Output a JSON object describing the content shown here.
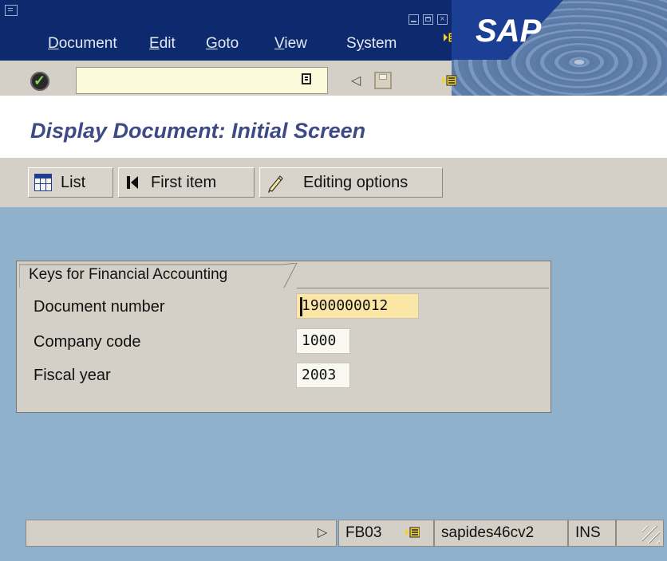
{
  "menubar": {
    "items": [
      {
        "label": "Document",
        "accel": "D",
        "rest": "ocument"
      },
      {
        "label": "Edit",
        "accel": "E",
        "rest": "dit"
      },
      {
        "label": "Goto",
        "accel": "G",
        "rest": "oto"
      },
      {
        "label": "View",
        "accel": "V",
        "rest": "iew"
      },
      {
        "label": "System",
        "pre": "S",
        "accel": "y",
        "rest": "stem"
      }
    ],
    "logo_text": "SAP"
  },
  "toolbar": {
    "command_field_value": "",
    "icons": [
      "ok-icon",
      "command-dropdown-icon",
      "back-icon",
      "save-icon",
      "layout-menu-icon"
    ]
  },
  "page": {
    "title": "Display Document: Initial Screen"
  },
  "app_toolbar": {
    "list_label": "List",
    "first_item_label": "First item",
    "editing_options_label": "Editing options"
  },
  "keys_group": {
    "title": "Keys for Financial Accounting",
    "fields": [
      {
        "label": "Document number",
        "value": "1900000012"
      },
      {
        "label": "Company code",
        "value": "1000"
      },
      {
        "label": "Fiscal year",
        "value": "2003"
      }
    ]
  },
  "status_bar": {
    "transaction": "FB03",
    "system": "sapides46cv2",
    "mode": "INS"
  },
  "colors": {
    "menubar_bg": "#0e2a6e",
    "title_text": "#3e4a84",
    "workarea_bg": "#8fb1cc",
    "panel_bg": "#d4d0c8",
    "focused_field_bg": "#fbe6a6"
  }
}
